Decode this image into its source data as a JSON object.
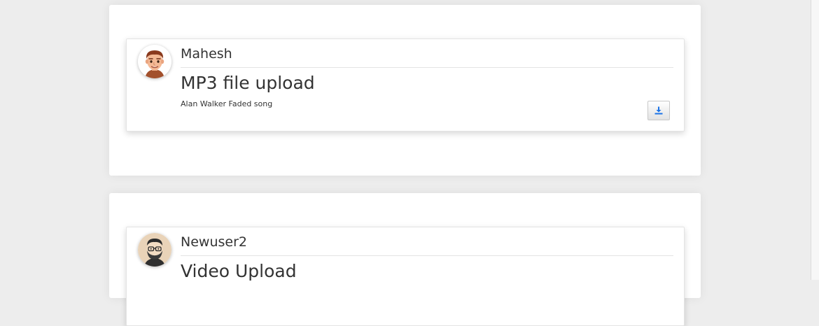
{
  "posts": [
    {
      "username": "Mahesh",
      "title": "MP3 file upload",
      "description": "Alan Walker Faded song",
      "avatar_icon": "cartoon-man-avatar",
      "action_icon": "download-icon"
    },
    {
      "username": "Newuser2",
      "title": "Video Upload",
      "avatar_icon": "cartoon-bearded-man-avatar"
    }
  ],
  "colors": {
    "accent": "#1a73e8",
    "page_background": "#ededed",
    "card_background": "#ffffff",
    "text": "#333333"
  }
}
